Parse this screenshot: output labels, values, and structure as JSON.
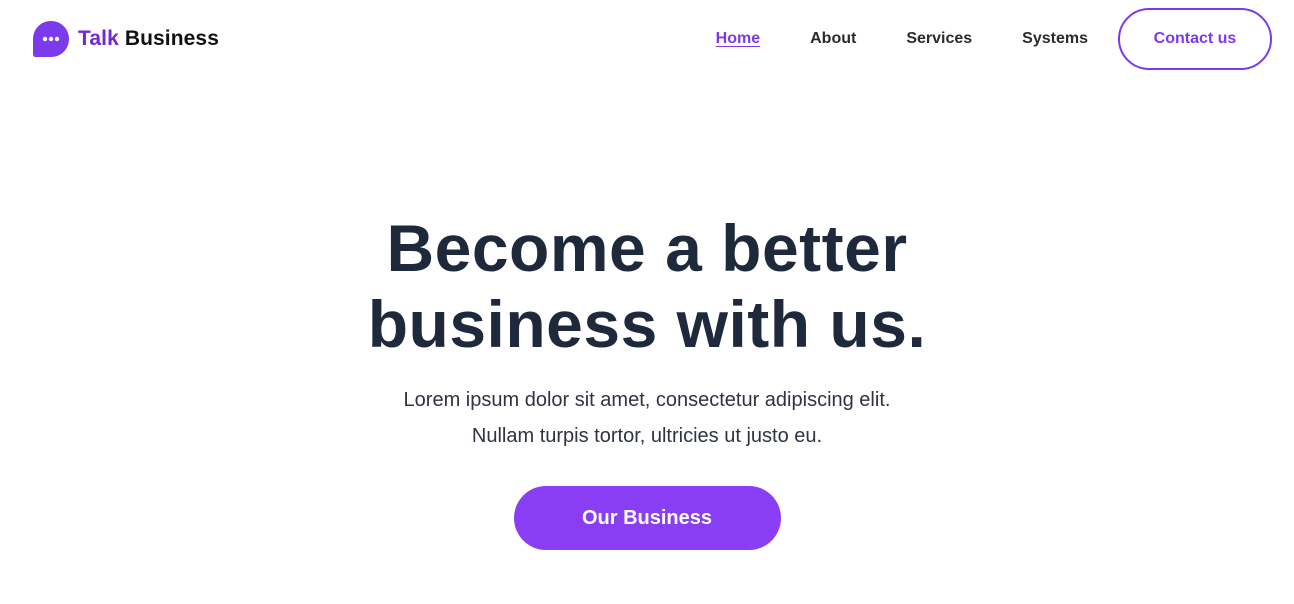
{
  "brand": {
    "name_part1": "Talk",
    "name_part2": "Business",
    "icon": "chat-bubble-dots-icon",
    "accent_color": "#6d28d9"
  },
  "nav": {
    "items": [
      {
        "label": "Home",
        "active": true
      },
      {
        "label": "About",
        "active": false
      },
      {
        "label": "Services",
        "active": false
      },
      {
        "label": "Systems",
        "active": false
      }
    ],
    "contact_label": "Contact us"
  },
  "hero": {
    "title_line1": "Become a better",
    "title_line2": "business with us.",
    "subtitle_line1": "Lorem ipsum dolor sit amet, consectetur adipiscing elit.",
    "subtitle_line2": "Nullam turpis tortor, ultricies ut justo eu.",
    "cta_label": "Our Business"
  },
  "colors": {
    "primary": "#8a3ef4",
    "heading": "#1e293b",
    "text": "#2f3442"
  }
}
